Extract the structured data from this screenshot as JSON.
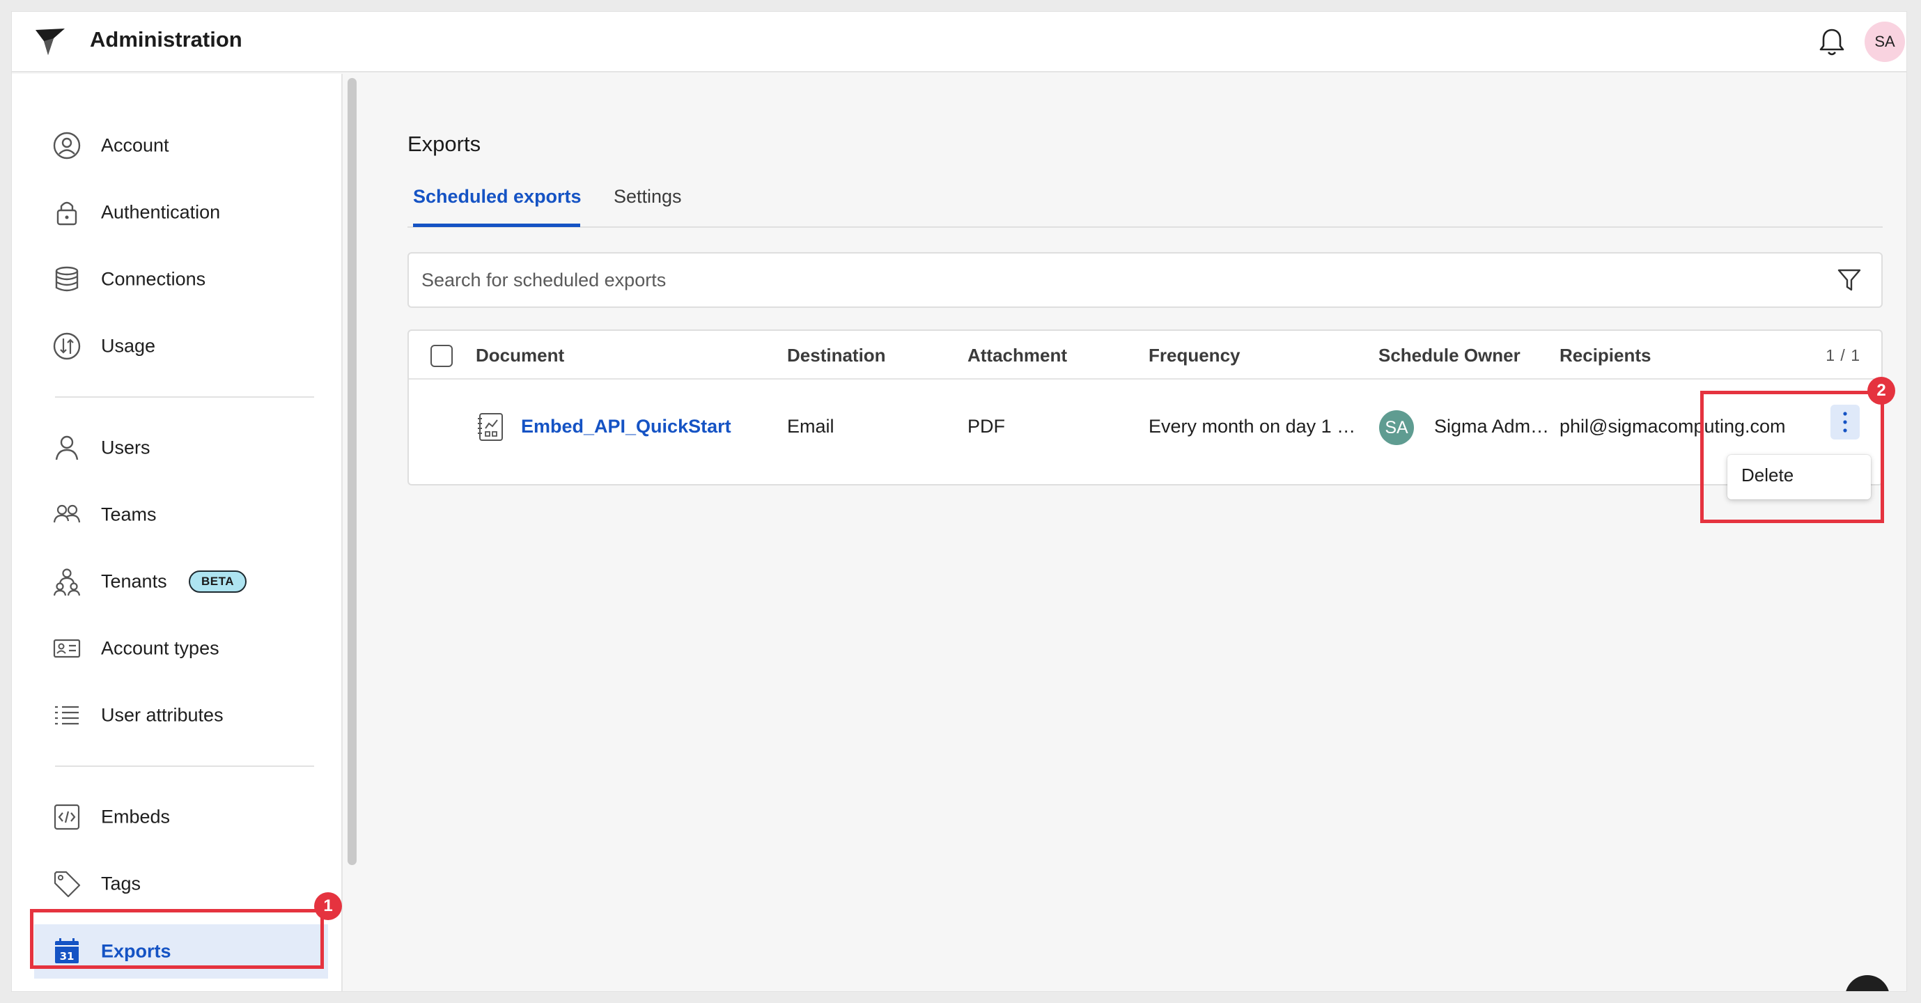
{
  "header": {
    "title": "Administration",
    "user_initials": "SA",
    "icons": {
      "logo": "sigma-logo",
      "notifications": "bell-icon"
    }
  },
  "sidebar": {
    "groups": [
      [
        {
          "label": "Account",
          "icon": "user-circle-icon"
        },
        {
          "label": "Authentication",
          "icon": "lock-icon"
        },
        {
          "label": "Connections",
          "icon": "database-icon"
        },
        {
          "label": "Usage",
          "icon": "usage-icon"
        }
      ],
      [
        {
          "label": "Users",
          "icon": "user-icon"
        },
        {
          "label": "Teams",
          "icon": "team-icon"
        },
        {
          "label": "Tenants",
          "icon": "tenants-icon",
          "badge": "BETA"
        },
        {
          "label": "Account types",
          "icon": "id-card-icon"
        },
        {
          "label": "User attributes",
          "icon": "list-icon"
        }
      ],
      [
        {
          "label": "Embeds",
          "icon": "code-icon"
        },
        {
          "label": "Tags",
          "icon": "tag-icon"
        },
        {
          "label": "Exports",
          "icon": "calendar-icon",
          "active": true
        }
      ]
    ],
    "active_item": "Exports"
  },
  "annotations": {
    "marker_1": "1",
    "marker_2": "2",
    "color": "#e5333f"
  },
  "main": {
    "title": "Exports",
    "tabs": [
      {
        "label": "Scheduled exports",
        "active": true
      },
      {
        "label": "Settings",
        "active": false
      }
    ],
    "search": {
      "placeholder": "Search for scheduled exports",
      "value": ""
    },
    "table": {
      "columns": [
        "Document",
        "Destination",
        "Attachment",
        "Frequency",
        "Schedule Owner",
        "Recipients"
      ],
      "pagination": "1 / 1",
      "rows": [
        {
          "document": "Embed_API_QuickStart",
          "destination": "Email",
          "attachment": "PDF",
          "frequency": "Every month on day 1 …",
          "owner_initials": "SA",
          "owner": "Sigma Adm…",
          "recipients": "phil@sigmacomputing.com"
        }
      ]
    },
    "row_menu": {
      "items": [
        "Delete"
      ]
    }
  },
  "colors": {
    "accent": "#1553c4",
    "active_bg": "#e3ebf9",
    "avatar_bg": "#f9d3e0",
    "owner_avatar_bg": "#5f9c91",
    "beta_bg": "#aee4f1"
  }
}
